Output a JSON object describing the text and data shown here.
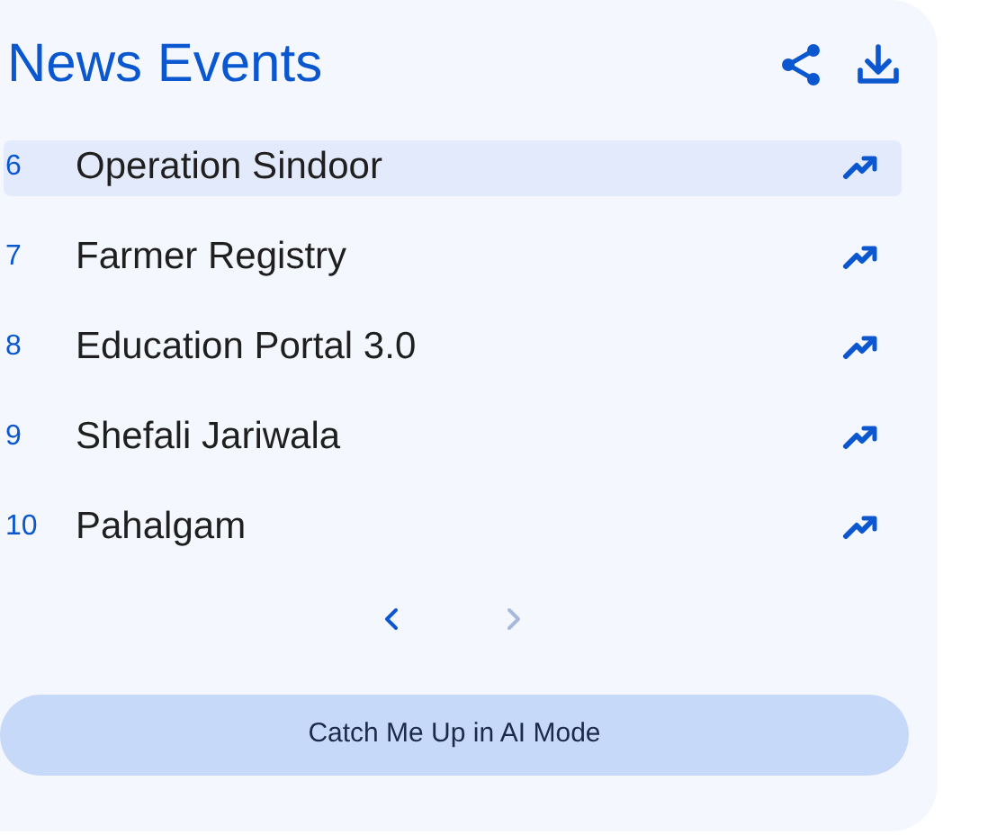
{
  "title": "News Events",
  "items": [
    {
      "rank": "6",
      "label": "Operation Sindoor",
      "selected": true
    },
    {
      "rank": "7",
      "label": "Farmer Registry",
      "selected": false
    },
    {
      "rank": "8",
      "label": "Education Portal 3.0",
      "selected": false
    },
    {
      "rank": "9",
      "label": "Shefali Jariwala",
      "selected": false
    },
    {
      "rank": "10",
      "label": "Pahalgam",
      "selected": false
    }
  ],
  "pager": {
    "prev_disabled": false,
    "next_disabled": true
  },
  "action_button": "Catch Me Up in AI Mode"
}
